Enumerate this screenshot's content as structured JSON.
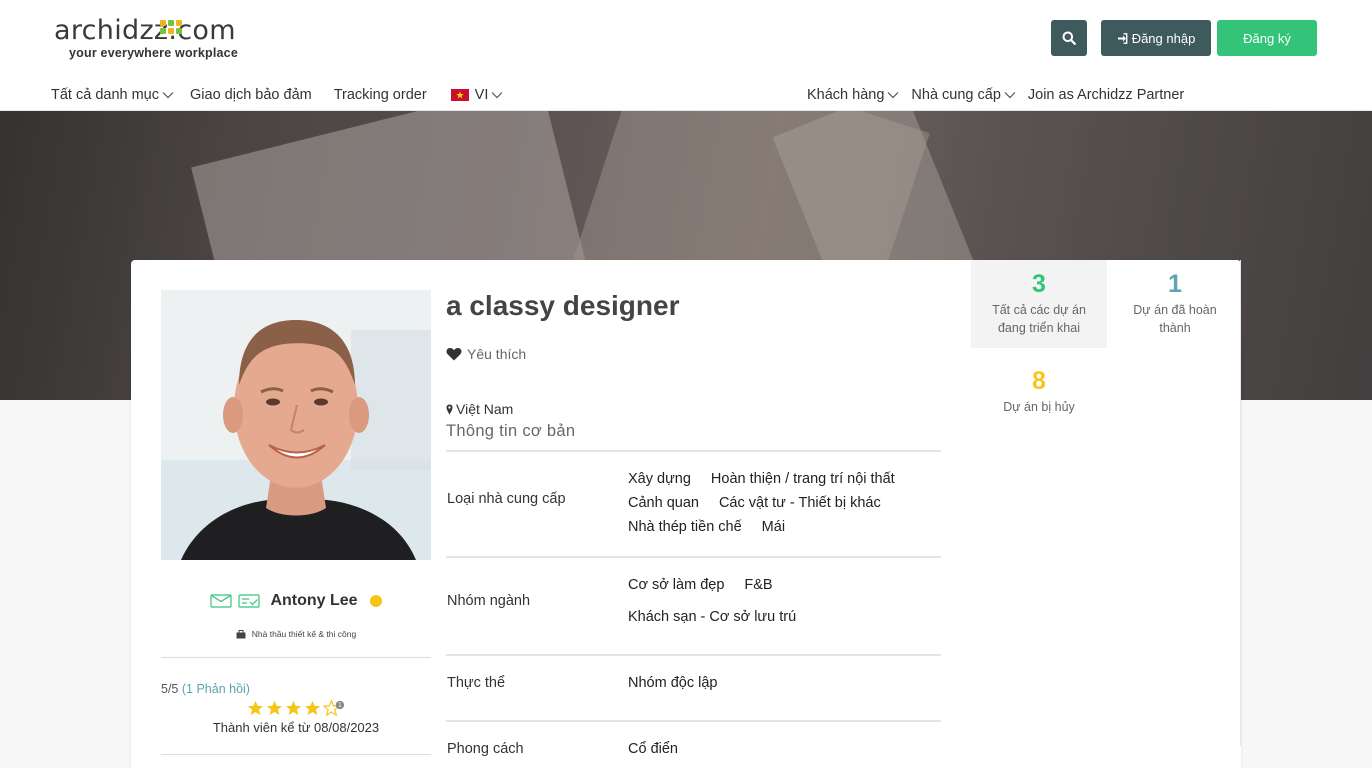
{
  "header": {
    "logo_main": "archidzz.com",
    "logo_sub": "your everywhere workplace",
    "login_label": "Đăng nhập",
    "register_label": "Đăng ký"
  },
  "nav": {
    "all_categories": "Tất cả danh mục",
    "escrow": "Giao dịch bảo đảm",
    "tracking": "Tracking order",
    "language": "VI",
    "customers": "Khách hàng",
    "suppliers": "Nhà cung cấp",
    "partner": "Join as Archidzz Partner"
  },
  "profile": {
    "title": "a classy designer",
    "favorite": "Yêu thích",
    "location": "Việt Nam",
    "basic_info": "Thông tin cơ bản",
    "name": "Antony Lee",
    "role": "Nhà thầu thiết kế & thi công",
    "rating": "5/5",
    "reviews": "(1 Phản hồi)",
    "rating_stars": 4,
    "member_since": "Thành viên kể từ 08/08/2023"
  },
  "info": {
    "supplier_type_label": "Loại nhà cung cấp",
    "supplier_type_line1a": "Xây dựng",
    "supplier_type_line1b": "Hoàn thiện / trang trí nội thất",
    "supplier_type_line2a": "Cảnh quan",
    "supplier_type_line2b": "Các vật tư - Thiết bị khác",
    "supplier_type_line3a": "Nhà thép tiền chế",
    "supplier_type_line3b": "Mái",
    "industry_label": "Nhóm ngành",
    "industry_line1a": "Cơ sở làm đẹp",
    "industry_line1b": "F&B",
    "industry_line2a": "Khách sạn - Cơ sở lưu trú",
    "entity_label": "Thực thể",
    "entity_value": "Nhóm độc lập",
    "style_label": "Phong cách",
    "style_value": "Cổ điển"
  },
  "stats": {
    "ongoing_num": "3",
    "ongoing_label": "Tất cả các dự án đang triển khai",
    "done_num": "1",
    "done_label": "Dự án đã hoàn thành",
    "cancelled_num": "8",
    "cancelled_label": "Dự án bị hủy"
  },
  "colors": {
    "green": "#33c47a",
    "teal": "#5ba4b0",
    "yellow": "#f5c518",
    "dark": "#3f5a5d"
  }
}
